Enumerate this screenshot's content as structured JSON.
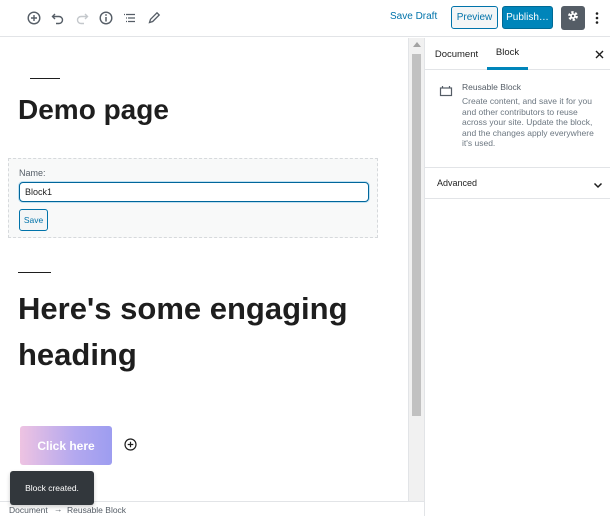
{
  "toolbar": {
    "icons": [
      "add-block-icon",
      "undo-icon",
      "redo-icon",
      "info-icon",
      "list-view-icon",
      "edit-icon"
    ],
    "save_draft": "Save Draft",
    "preview": "Preview",
    "publish": "Publish…",
    "settings_icon": "gear-icon",
    "more_icon": "more-vertical-icon"
  },
  "editor": {
    "page_title": "Demo page",
    "reusable_form": {
      "name_label": "Name:",
      "name_value": "Block1",
      "save_label": "Save"
    },
    "heading": "Here's some engaging heading",
    "button_text": "Click here"
  },
  "sidebar": {
    "tabs": [
      {
        "label": "Document",
        "active": false
      },
      {
        "label": "Block",
        "active": true
      }
    ],
    "close_icon": "close-icon",
    "block_card": {
      "icon": "reusable-block-icon",
      "title": "Reusable Block",
      "description": "Create content, and save it for you and other contributors to reuse across your site. Update the block, and the changes apply everywhere it's used."
    },
    "advanced_label": "Advanced"
  },
  "footer": {
    "breadcrumb": [
      "Document",
      "Reusable Block"
    ],
    "separator": "→"
  },
  "snackbar": "Block created.",
  "colors": {
    "accent": "#0085ba",
    "link": "#0073aa",
    "dark_button": "#555d66",
    "snackbar_bg": "#32373c"
  }
}
